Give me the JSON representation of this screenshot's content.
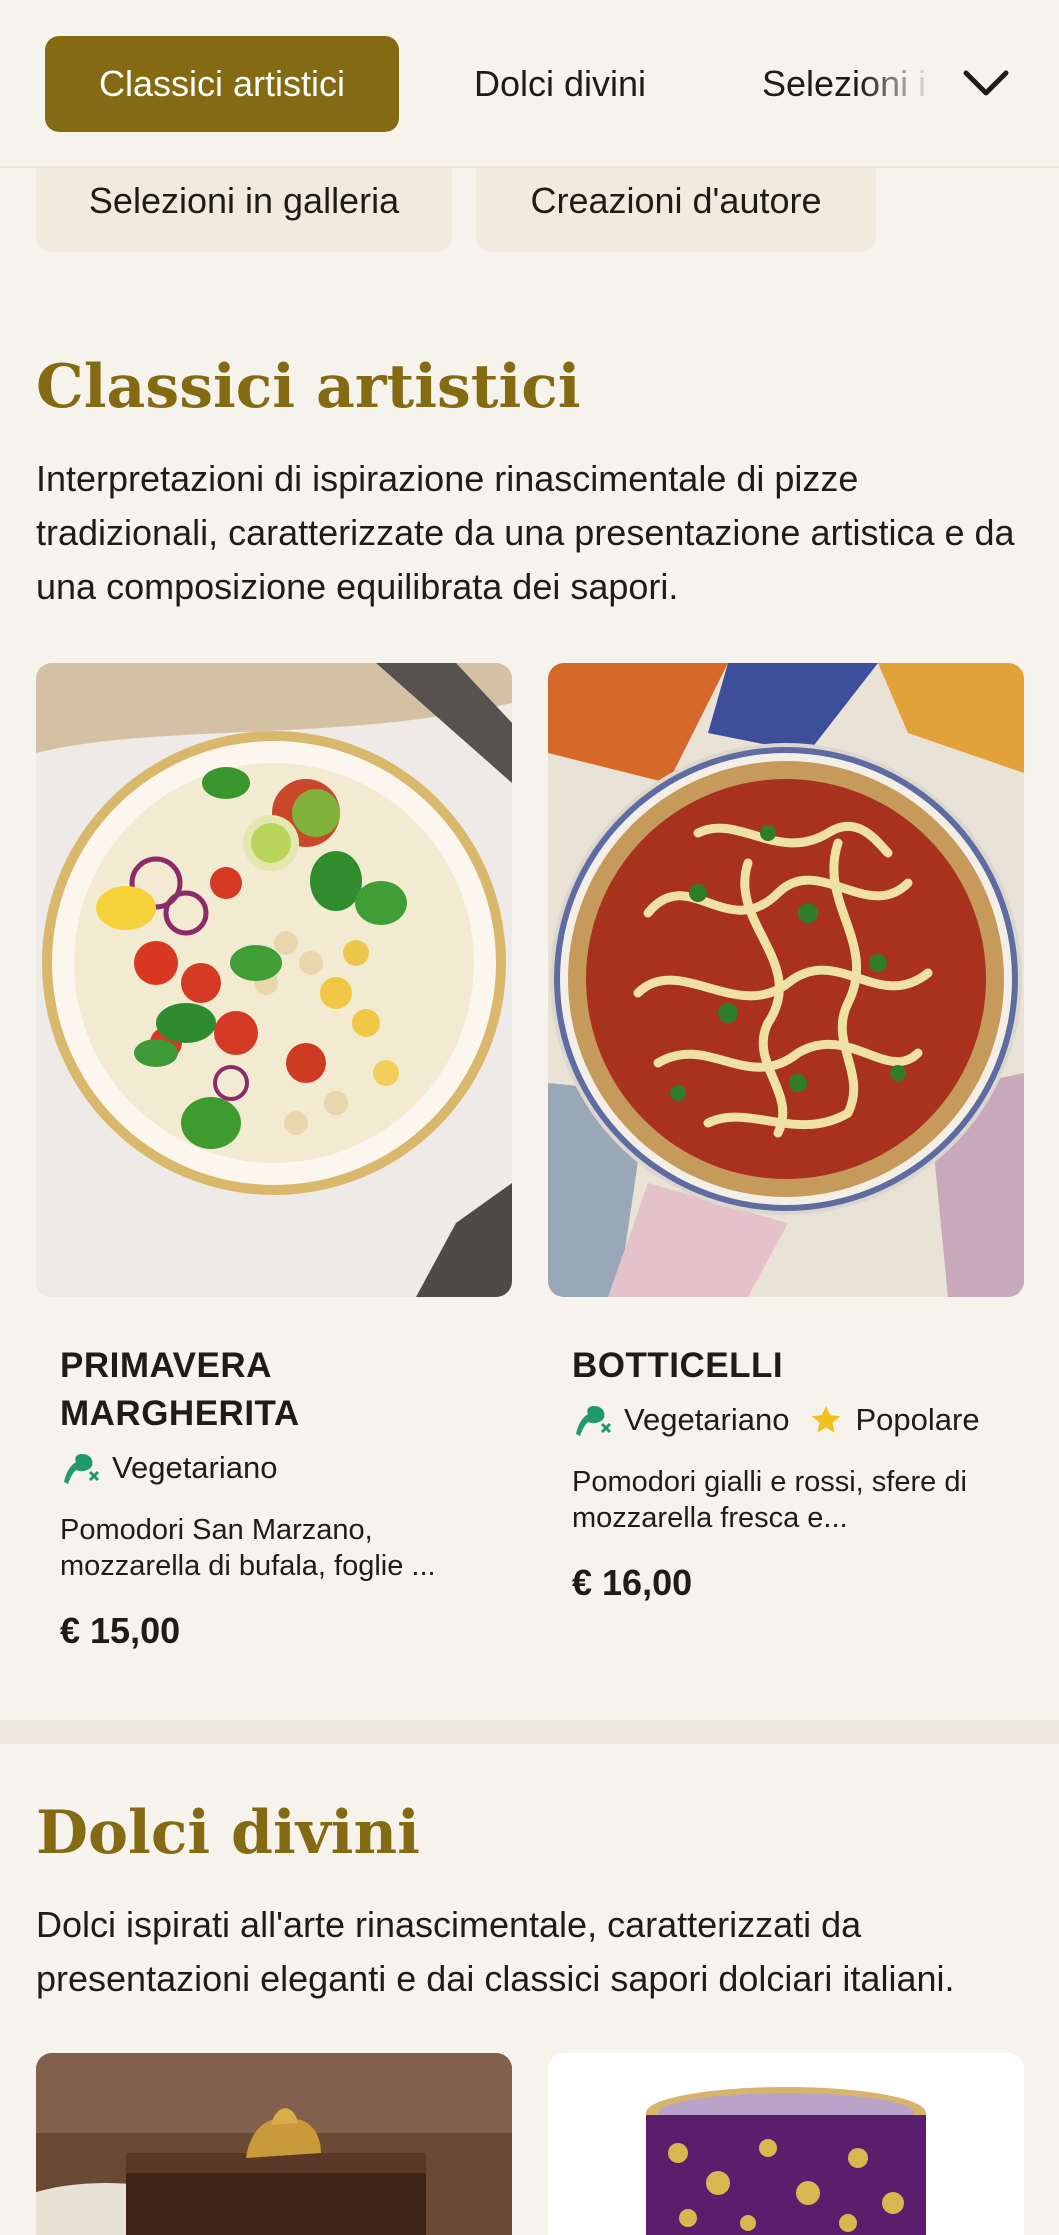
{
  "nav": {
    "tabs": [
      {
        "label": "Classici artistici",
        "active": true
      },
      {
        "label": "Dolci divini",
        "active": false
      },
      {
        "label": "Selezioni i",
        "active": false
      }
    ],
    "expand_icon": "chevron-down-icon"
  },
  "chips": [
    {
      "label": "Selezioni in galleria"
    },
    {
      "label": "Creazioni d'autore"
    }
  ],
  "sections": [
    {
      "title": "Classici artistici",
      "description": "Interpretazioni di ispirazione rinascimentale di pizze tradizionali, caratterizzate da una presentazione artistica e da una composizione equilibrata dei sapori.",
      "items": [
        {
          "name": "PRIMAVERA MARGHERITA",
          "tags": [
            {
              "label": "Vegetariano",
              "icon": "vegetarian-icon"
            }
          ],
          "description": "Pomodori San Marzano, mozzarella di bufala, foglie ...",
          "price": "€ 15,00"
        },
        {
          "name": "BOTTICELLI",
          "tags": [
            {
              "label": "Vegetariano",
              "icon": "vegetarian-icon"
            },
            {
              "label": "Popolare",
              "icon": "star-icon"
            }
          ],
          "description": "Pomodori gialli e rossi, sfere di mozzarella fresca e...",
          "price": "€ 16,00"
        }
      ]
    },
    {
      "title": "Dolci divini",
      "description": "Dolci ispirati all'arte rinascimentale, caratterizzati da presentazioni eleganti e dai classici sapori dolciari italiani.",
      "items": []
    }
  ],
  "colors": {
    "accent": "#846a12",
    "background": "#f6f3ec",
    "chip": "#efebdf",
    "vegetarian": "#1f9b6b",
    "star": "#f2c01e"
  }
}
